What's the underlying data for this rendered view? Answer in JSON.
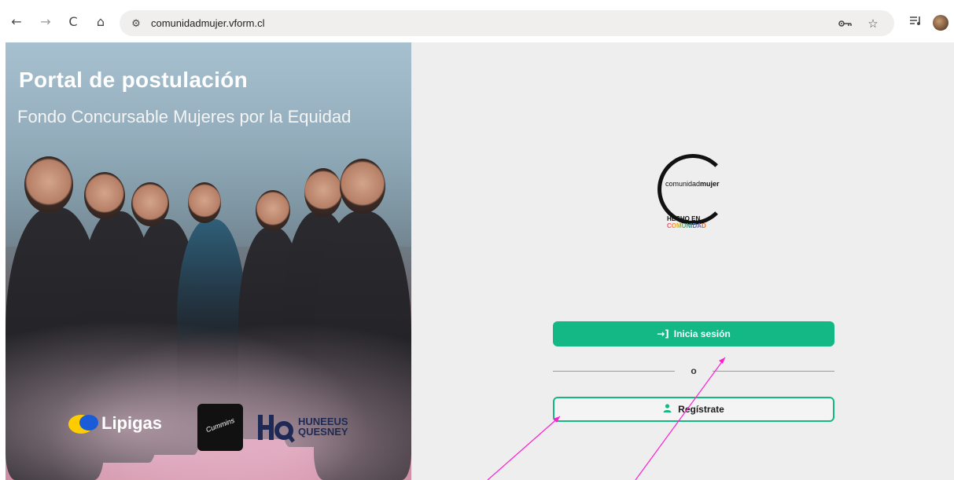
{
  "browser": {
    "url": "comunidadmujer.vform.cl",
    "back_icon": "←",
    "forward_icon": "→",
    "reload_icon": "C",
    "home_icon": "⌂",
    "tune_icon": "⚙",
    "key_icon": "key-icon",
    "star_icon": "☆",
    "reading_list_icon": "≡"
  },
  "hero": {
    "title": "Portal de postulación",
    "subtitle": "Fondo Concursable Mujeres por la Equidad",
    "sponsors": {
      "lipigas": "Lipigas",
      "cummins": "Cummins",
      "hq_line1": "HUNEEUS",
      "hq_line2": "QUESNEY"
    }
  },
  "logo": {
    "text_light": "comunidad",
    "text_bold": "mujer",
    "tagline_line1": "HECHO EN",
    "tagline_line2": "COMUNIDAD"
  },
  "auth": {
    "login_label": "Inicia sesión",
    "login_icon": "→]",
    "divider_text": "o",
    "register_label": "Regístrate",
    "register_icon": "👤"
  },
  "colors": {
    "accent": "#14b885",
    "annotation": "#ff1fd1"
  }
}
